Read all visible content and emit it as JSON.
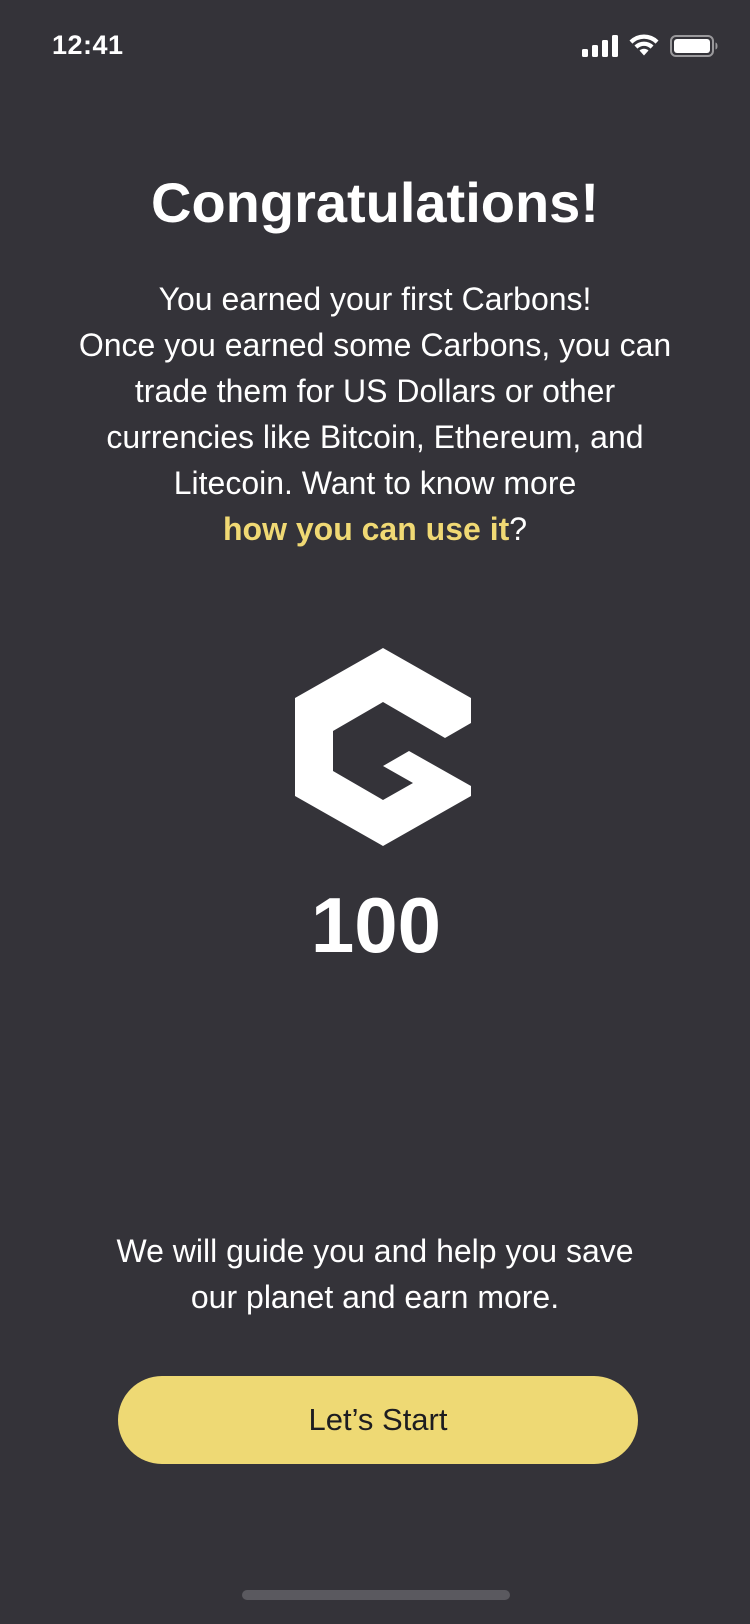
{
  "status_bar": {
    "time": "12:41"
  },
  "screen": {
    "title": "Congratulations!",
    "description_lines": [
      "You earned your first Carbons!",
      "Once you earned some Carbons, you can",
      "trade them for US Dollars or other",
      "currencies like Bitcoin, Ethereum, and",
      "Litecoin. Want to know more"
    ],
    "link_text": "how you can use it",
    "link_suffix": "?",
    "logo_icon": "carbon-logo-icon",
    "amount": "100",
    "guide_lines": [
      "We will guide you and help you save",
      "our planet and earn more."
    ],
    "start_button_label": "Let’s Start"
  },
  "colors": {
    "background": "#343339",
    "accent": "#eed974",
    "text": "#ffffff"
  }
}
